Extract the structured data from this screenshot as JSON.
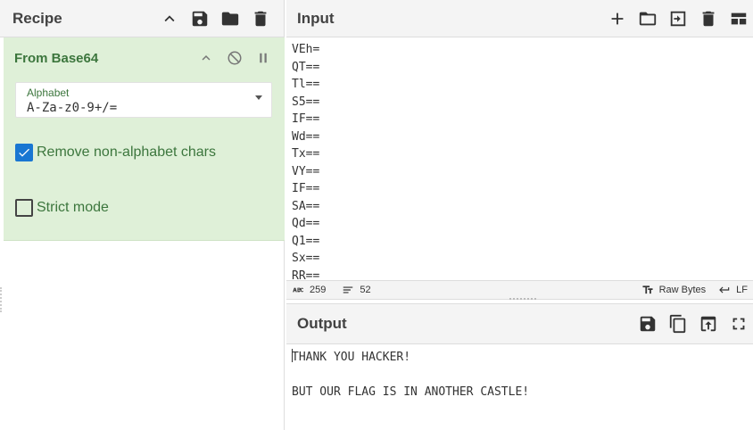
{
  "recipe": {
    "title": "Recipe",
    "operation": {
      "name": "From Base64",
      "alphabet_label": "Alphabet",
      "alphabet_value": "A-Za-z0-9+/=",
      "remove_non_alpha_label": "Remove non-alphabet chars",
      "remove_non_alpha_checked": true,
      "strict_mode_label": "Strict mode",
      "strict_mode_checked": false
    }
  },
  "input": {
    "title": "Input",
    "lines": [
      "VEh=",
      "QT==",
      "Tl==",
      "S5==",
      "IF==",
      "Wd==",
      "Tx==",
      "VY==",
      "IF==",
      "SA==",
      "Qd==",
      "Q1==",
      "Sx==",
      "RR=="
    ],
    "status": {
      "length": "259",
      "lines": "52",
      "encoding": "Raw Bytes",
      "eol": "LF"
    }
  },
  "output": {
    "title": "Output",
    "lines": [
      "THANK YOU HACKER!",
      "",
      "BUT OUR FLAG IS IN ANOTHER CASTLE!"
    ]
  },
  "icons": {
    "accent": "#1976d2",
    "op_bg": "#dff0d8",
    "op_text": "#3c763d"
  }
}
